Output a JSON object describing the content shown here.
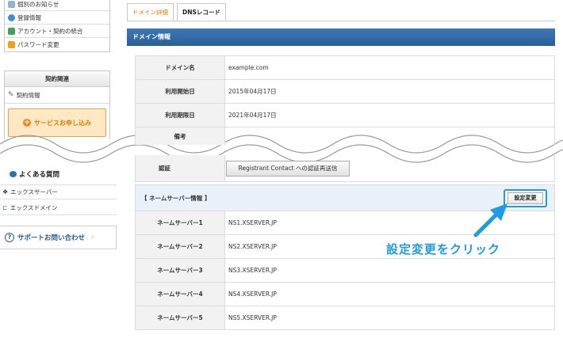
{
  "sidebar": {
    "top_items": [
      {
        "label": "個別のお知らせ",
        "icon": "notice-icon",
        "color": "#8fb3d9"
      },
      {
        "label": "登録情報",
        "icon": "person-icon",
        "color": "#3d8fd6"
      },
      {
        "label": "アカウント・契約の統合",
        "icon": "merge-icon",
        "color": "#3fa35a"
      },
      {
        "label": "パスワード変更",
        "icon": "lock-icon",
        "color": "#f0a21c"
      }
    ],
    "contract_section": {
      "title": "契約関連",
      "items": [
        {
          "label": "契約情報",
          "icon": "pencil-icon"
        }
      ],
      "apply_label": "サービスお申し込み"
    },
    "faq": {
      "title": "よくある質問",
      "links": [
        {
          "label": "エックスサーバー",
          "icon": "diamond-icon"
        },
        {
          "label": "エックスドメイン",
          "icon": "x-domain-icon"
        }
      ]
    },
    "support_label": "サポートお問い合わせ"
  },
  "tabs": [
    {
      "label": "ドメイン詳細",
      "active": true
    },
    {
      "label": "DNSレコード",
      "active": false
    }
  ],
  "domain_info": {
    "section_title": "ドメイン情報",
    "rows": [
      {
        "label": "ドメイン名",
        "value": "example.com"
      },
      {
        "label": "利用開始日",
        "value": "2015年04月17日"
      },
      {
        "label": "利用期限日",
        "value": "2021年04月17日"
      },
      {
        "label": "備考",
        "value": ""
      }
    ],
    "partial_label": "認証",
    "registrant_button": "Registrant Contact への認証再送信"
  },
  "nameservers": {
    "header": "【 ネームサーバー情報 】",
    "edit_button": "設定変更",
    "rows": [
      {
        "label": "ネームサーバー1",
        "value": "NS1.XSERVER.JP"
      },
      {
        "label": "ネームサーバー2",
        "value": "NS2.XSERVER.JP"
      },
      {
        "label": "ネームサーバー3",
        "value": "NS3.XSERVER.JP"
      },
      {
        "label": "ネームサーバー4",
        "value": "NS4.XSERVER.JP"
      },
      {
        "label": "ネームサーバー5",
        "value": "NS5.XSERVER.JP"
      }
    ]
  },
  "annotation": {
    "text": "設定変更をクリック",
    "color": "#1e9be8"
  }
}
